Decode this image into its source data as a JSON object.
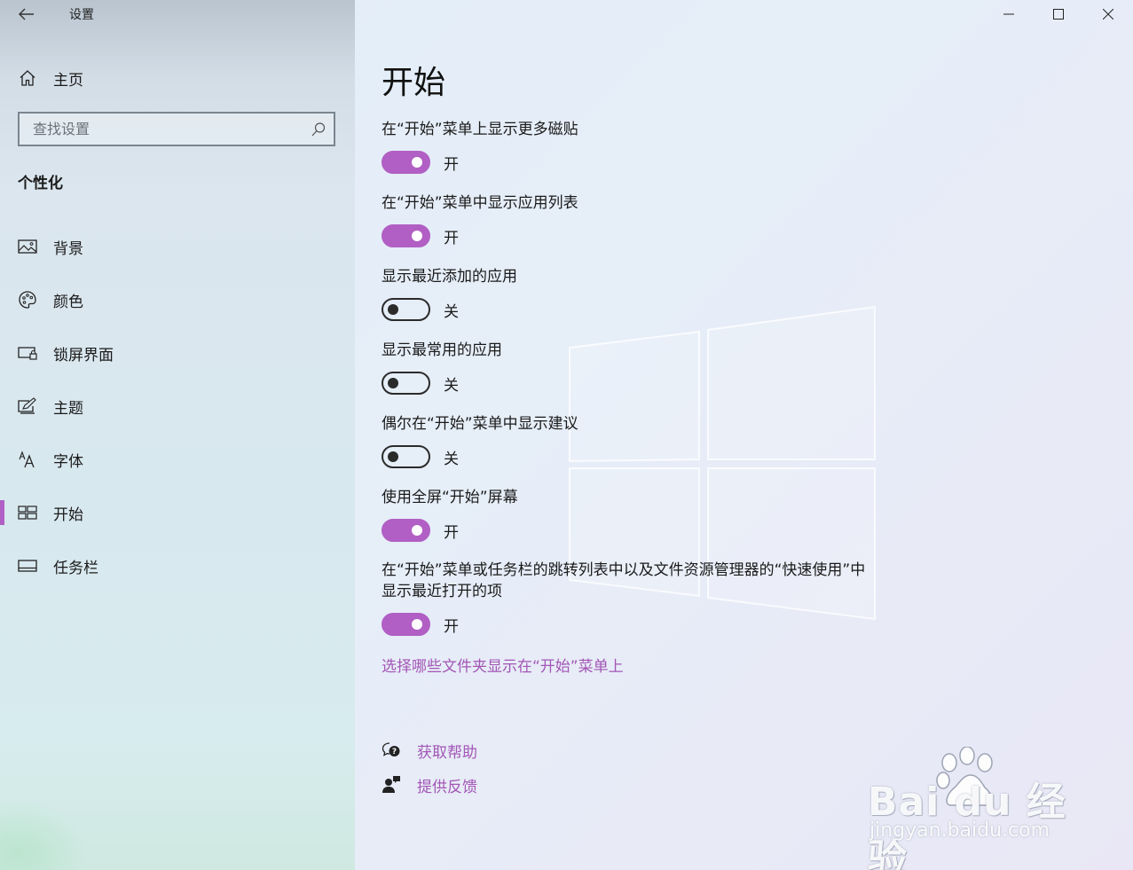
{
  "window": {
    "title": "设置",
    "controls": [
      "minimize-icon",
      "maximize-icon",
      "close-icon"
    ]
  },
  "sidebar": {
    "home_label": "主页",
    "search": {
      "placeholder": "查找设置",
      "value": ""
    },
    "section_title": "个性化",
    "items": [
      {
        "label": "背景",
        "icon": "picture-icon",
        "active": false
      },
      {
        "label": "颜色",
        "icon": "palette-icon",
        "active": false
      },
      {
        "label": "锁屏界面",
        "icon": "lock-screen-icon",
        "active": false
      },
      {
        "label": "主题",
        "icon": "theme-icon",
        "active": false
      },
      {
        "label": "字体",
        "icon": "font-icon",
        "active": false
      },
      {
        "label": "开始",
        "icon": "start-icon",
        "active": true
      },
      {
        "label": "任务栏",
        "icon": "taskbar-icon",
        "active": false
      }
    ]
  },
  "main": {
    "title": "开始",
    "settings": [
      {
        "title": "在“开始”菜单上显示更多磁贴",
        "on": true,
        "state": "开"
      },
      {
        "title": "在“开始”菜单中显示应用列表",
        "on": true,
        "state": "开"
      },
      {
        "title": "显示最近添加的应用",
        "on": false,
        "state": "关"
      },
      {
        "title": "显示最常用的应用",
        "on": false,
        "state": "关"
      },
      {
        "title": "偶尔在“开始”菜单中显示建议",
        "on": false,
        "state": "关"
      },
      {
        "title": "使用全屏“开始”屏幕",
        "on": true,
        "state": "开"
      },
      {
        "title_line1": "在“开始”菜单或任务栏的跳转列表中以及文件资源管理器的“快速使用”中",
        "title_line2": "显示最近打开的项",
        "on": true,
        "state": "开"
      }
    ],
    "folders_link": "选择哪些文件夹显示在“开始”菜单上",
    "help_link": "获取帮助",
    "feedback_link": "提供反馈"
  },
  "watermark": {
    "brand": "Bai du 经验",
    "url": "jingyan.baidu.com"
  },
  "colors": {
    "accent": "#b15fc4",
    "link": "#a356b6",
    "toggle_off": "#2b2b2b"
  }
}
